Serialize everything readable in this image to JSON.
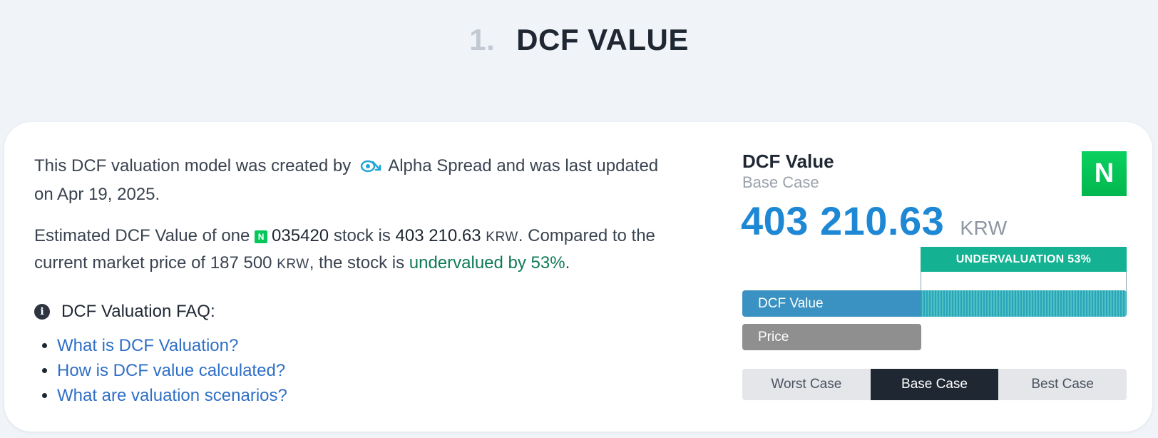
{
  "section": {
    "number": "1.",
    "title": "DCF VALUE"
  },
  "intro": {
    "text_before": "This DCF valuation model was created by",
    "brand": "Alpha Spread",
    "text_after": "and was last updated on",
    "date": "Apr 19, 2025."
  },
  "estimate": {
    "prefix": "Estimated DCF Value of one",
    "ticker_logo": "N",
    "ticker": "035420",
    "mid": "stock is",
    "value": "403 210.63",
    "currency": "KRW",
    "compare": ". Compared to the current market price of",
    "price": "187 500",
    "price_currency": "KRW",
    "suffix": ", the stock is",
    "verdict": "undervalued by 53%",
    "end": "."
  },
  "faq": {
    "heading": "DCF Valuation FAQ:",
    "items": [
      "What is DCF Valuation?",
      "How is DCF value calculated?",
      "What are valuation scenarios?"
    ]
  },
  "panel": {
    "title": "DCF Value",
    "subtitle": "Base Case",
    "logo": "N",
    "value": "403 210.63",
    "currency": "KRW",
    "undervaluation_label": "UNDERVALUATION 53%",
    "dcf_bar_label": "DCF Value",
    "price_bar_label": "Price",
    "scenarios": [
      "Worst Case",
      "Base Case",
      "Best Case"
    ],
    "active_scenario": "Base Case"
  },
  "colors": {
    "accent_blue": "#1e88d4",
    "undervaluation_green": "#14b292",
    "text_green": "#0f7a56",
    "brand_logo_green": "#03c75a"
  }
}
